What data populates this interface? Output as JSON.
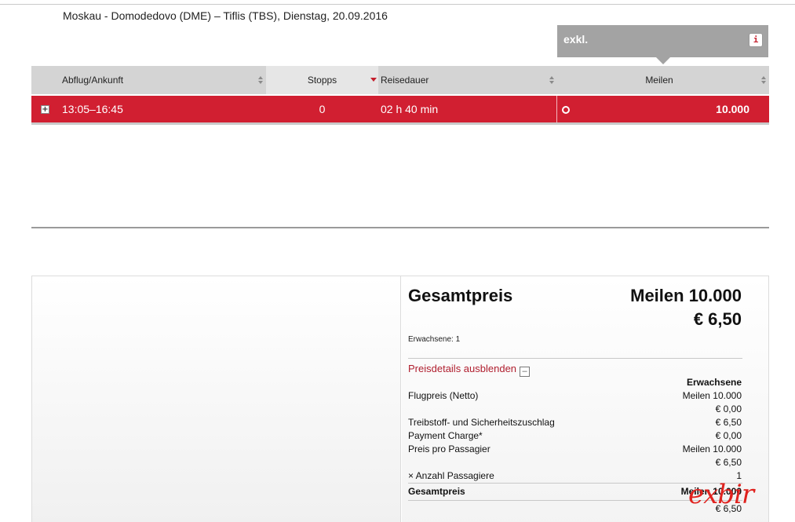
{
  "route": {
    "title": "Moskau - Domodedovo (DME) – Tiflis (TBS),  Dienstag, 20.09.2016"
  },
  "fare_box": {
    "label": "exkl.",
    "info_icon": "i"
  },
  "table": {
    "headers": {
      "departure_arrival": "Abflug/Ankunft",
      "stops": "Stopps",
      "duration": "Reisedauer",
      "miles": "Meilen"
    },
    "rows": [
      {
        "expand": "+",
        "time": "13:05–16:45",
        "stops": "0",
        "duration": "02 h 40 min",
        "miles": "10.000"
      }
    ]
  },
  "price": {
    "title": "Gesamtpreis",
    "miles_total": "Meilen 10.000",
    "euro_total": "€ 6,50",
    "adults": "Erwachsene: 1",
    "toggle": "Preisdetails ausblenden",
    "toggle_icon": "–",
    "column_header": "Erwachsene",
    "lines": [
      {
        "label": "Flugpreis (Netto)",
        "value": "Meilen 10.000"
      },
      {
        "label": "",
        "value": "€ 0,00"
      },
      {
        "label": "Treibstoff- und Sicherheitszuschlag",
        "value": "€ 6,50"
      },
      {
        "label": "Payment Charge*",
        "value": "€ 0,00"
      },
      {
        "label": "Preis pro Passagier",
        "value": "Meilen 10.000"
      },
      {
        "label": "",
        "value": "€ 6,50"
      },
      {
        "label": "× Anzahl Passagiere",
        "value": "1"
      }
    ],
    "total_label": "Gesamtpreis",
    "total_miles": "Meilen 10.000",
    "total_euro": "€ 6,50"
  },
  "watermark": "exbir"
}
